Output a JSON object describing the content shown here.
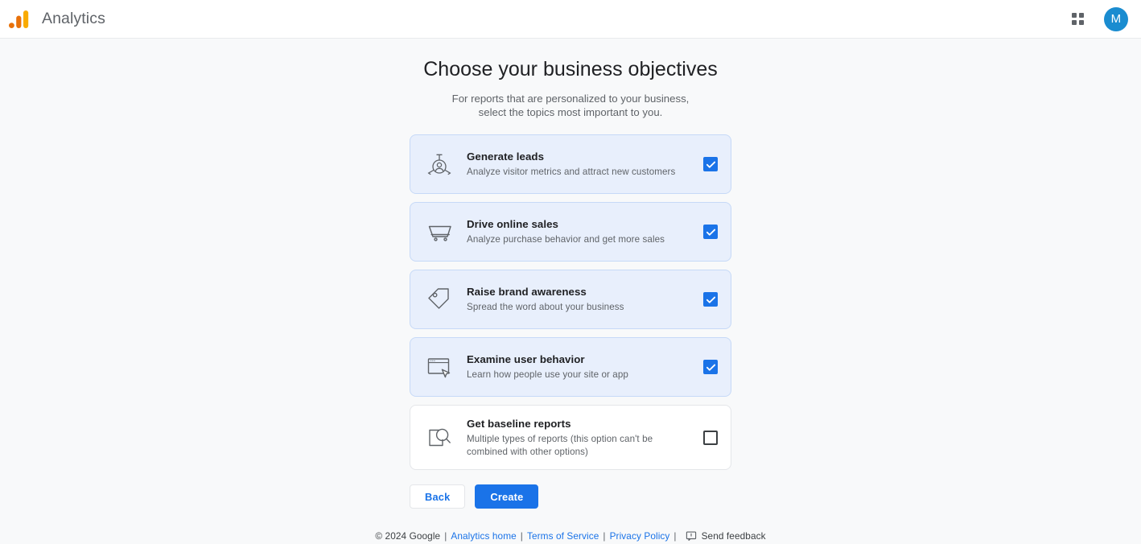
{
  "topbar": {
    "logo_icon": "analytics-bars-icon",
    "brand_name": "Analytics",
    "apps_icon": "apps-grid-icon",
    "avatar_initial": "M",
    "avatar_color": "#1a8cd0"
  },
  "main": {
    "title": "Choose your business objectives",
    "subtitle_line1": "For reports that are personalized to your business,",
    "subtitle_line2": "select the topics most important to you."
  },
  "objectives": [
    {
      "icon": "lead-person-target-icon",
      "title": "Generate leads",
      "description": "Analyze visitor metrics and attract new customers",
      "checked": true
    },
    {
      "icon": "shopping-cart-icon",
      "title": "Drive online sales",
      "description": "Analyze purchase behavior and get more sales",
      "checked": true
    },
    {
      "icon": "price-tag-icon",
      "title": "Raise brand awareness",
      "description": "Spread the word about your business",
      "checked": true
    },
    {
      "icon": "browser-cursor-icon",
      "title": "Examine user behavior",
      "description": "Learn how people use your site or app",
      "checked": true
    },
    {
      "icon": "document-magnifier-icon",
      "title": "Get baseline reports",
      "description": "Multiple types of reports (this option can't be combined with other options)",
      "checked": false
    }
  ],
  "actions": {
    "back_label": "Back",
    "create_label": "Create",
    "primary_color": "#1a73e8"
  },
  "footer": {
    "copyright": "© 2024 Google",
    "sep": "|",
    "link_home": "Analytics home",
    "link_terms": "Terms of Service",
    "link_privacy": "Privacy Policy",
    "feedback_icon": "feedback-bubble-icon",
    "feedback_label": "Send feedback"
  }
}
